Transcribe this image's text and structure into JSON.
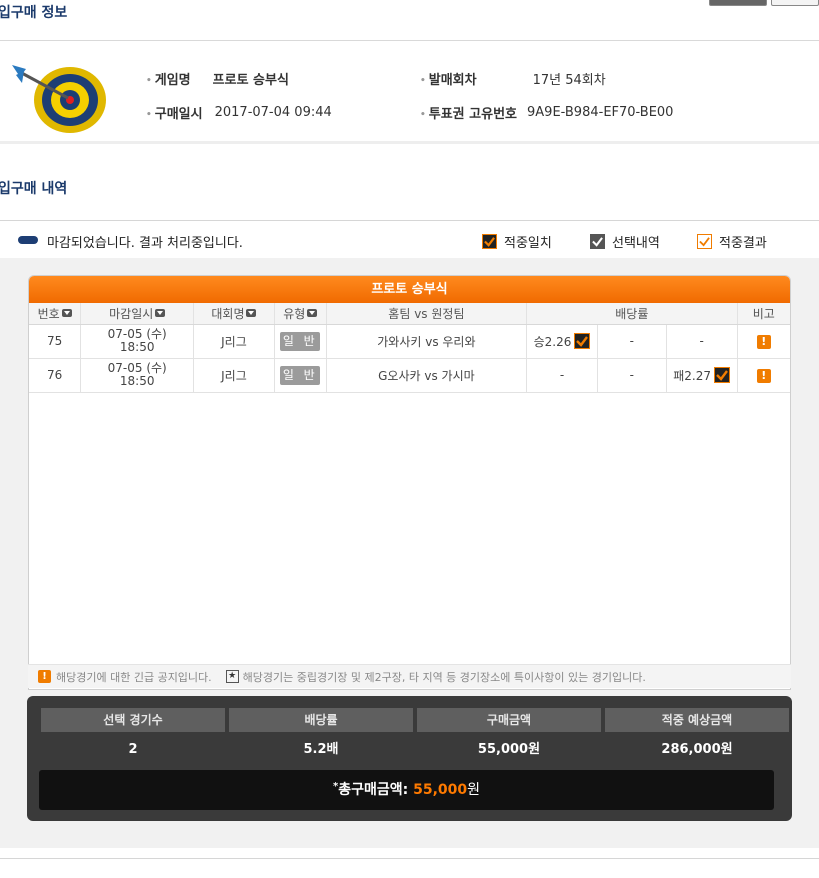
{
  "purchase_info": {
    "section_title": "입구매 정보",
    "game_name_label": "게임명",
    "game_name_value": "프로토 승부식",
    "round_label": "발매회차",
    "round_value": "17년 54회차",
    "purchase_time_label": "구매일시",
    "purchase_time_value": "2017-07-04 09:44",
    "ticket_id_label": "투표권 고유번호",
    "ticket_id_value": "9A9E-B984-EF70-BE00"
  },
  "purchase_list": {
    "section_title": "입구매 내역",
    "status_text": "마감되었습니다. 결과 처리중입니다.",
    "legend": [
      {
        "label": "적중일치",
        "icon": "check-filled-icon",
        "color": "#f07c00"
      },
      {
        "label": "선택내역",
        "icon": "check-gray-icon",
        "color": "#555555"
      },
      {
        "label": "적중결과",
        "icon": "check-outline-icon",
        "color": "#f07c00"
      }
    ]
  },
  "table": {
    "title": "프로토 승부식",
    "headers": {
      "no": "번호",
      "deadline": "마감일시",
      "league": "대회명",
      "type": "유형",
      "teams": "홈팀 vs 원정팀",
      "odds": "배당률",
      "note": "비고"
    },
    "rows": [
      {
        "no": "75",
        "date": "07-05 (수)",
        "time": "18:50",
        "league": "J리그",
        "type": "일 반",
        "teams": "가와사키 vs 우리와",
        "win": "승2.26",
        "draw": "-",
        "lose": "-",
        "note": "!"
      },
      {
        "no": "76",
        "date": "07-05 (수)",
        "time": "18:50",
        "league": "J리그",
        "type": "일 반",
        "teams": "G오사카 vs 가시마",
        "win": "-",
        "draw": "-",
        "lose": "패2.27",
        "note": "!"
      }
    ],
    "notice_1": "해당경기에 대한 긴급 공지입니다.",
    "notice_2": "해당경기는 중립경기장 및 제2구장, 타 지역 등 경기장소에 특이사항이 있는 경기입니다."
  },
  "summary": {
    "headers": [
      "선택 경기수",
      "배당률",
      "구매금액",
      "적중 예상금액"
    ],
    "values": [
      "2",
      "5.2배",
      "55,000원",
      "286,000원"
    ],
    "total_label": "총구매금액:",
    "total_amount": "55,000",
    "total_unit": "원"
  }
}
